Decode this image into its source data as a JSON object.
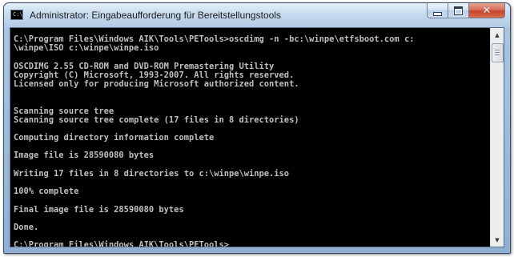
{
  "window": {
    "title": "Administrator: Eingabeaufforderung für Bereitstellungstools",
    "app_icon": "cmd-icon",
    "icon_glyph": "C:\\",
    "buttons": {
      "minimize_icon": "minimize-icon",
      "maximize_icon": "maximize-icon",
      "close_icon": "close-icon",
      "close_glyph": "✕"
    }
  },
  "console": {
    "background": "#000000",
    "text_color": "#c0c0c0",
    "lines": [
      "C:\\Program Files\\Windows AIK\\Tools\\PETools>oscdimg -n -bc:\\winpe\\etfsboot.com c:",
      "\\winpe\\ISO c:\\winpe\\winpe.iso",
      "",
      "OSCDIMG 2.55 CD-ROM and DVD-ROM Premastering Utility",
      "Copyright (C) Microsoft, 1993-2007. All rights reserved.",
      "Licensed only for producing Microsoft authorized content.",
      "",
      "",
      "Scanning source tree",
      "Scanning source tree complete (17 files in 8 directories)",
      "",
      "Computing directory information complete",
      "",
      "Image file is 28590080 bytes",
      "",
      "Writing 17 files in 8 directories to c:\\winpe\\winpe.iso",
      "",
      "100% complete",
      "",
      "Final image file is 28590080 bytes",
      "",
      "Done.",
      "",
      "C:\\Program Files\\Windows AIK\\Tools\\PETools>"
    ]
  },
  "scrollbar": {
    "up_icon": "scroll-up-arrow-icon",
    "down_icon": "scroll-down-arrow-icon",
    "up_glyph": "▲",
    "down_glyph": "▼"
  }
}
